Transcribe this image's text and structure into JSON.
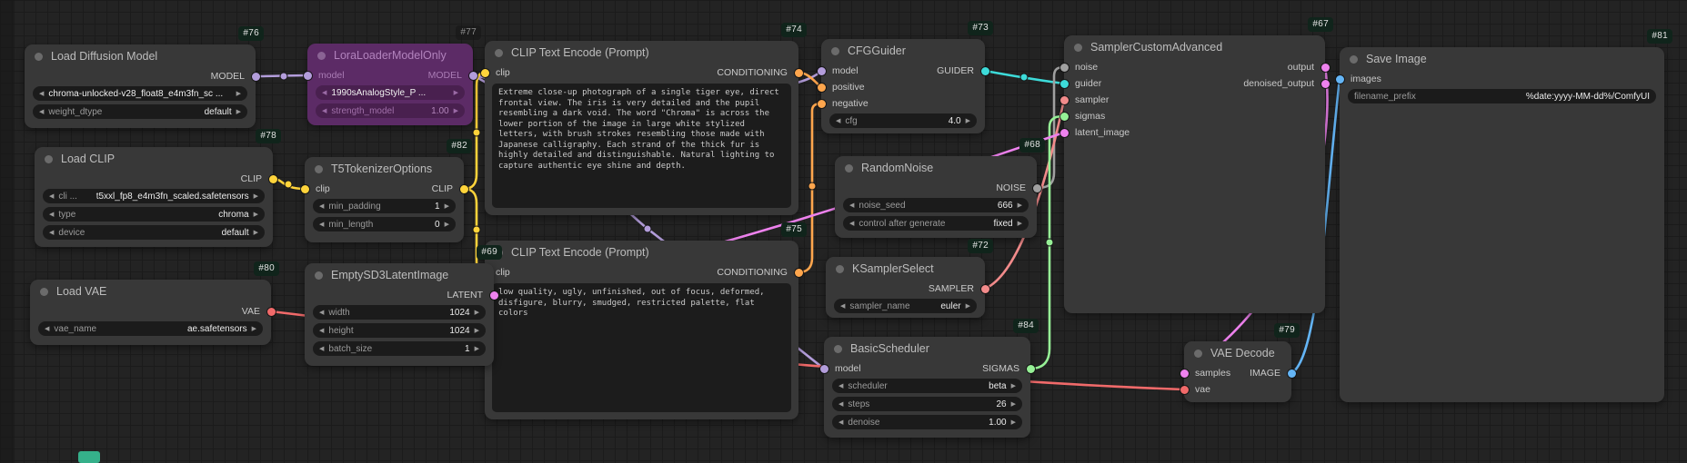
{
  "app": {
    "name": "ComfyUI workflow graph"
  },
  "colors": {
    "MODEL": "#b39ddb",
    "CLIP": "#ffd43b",
    "CONDITIONING": "#ffa64d",
    "GUIDER": "#3ddbd9",
    "NOISE": "#a0a0a0",
    "SAMPLER": "#f28b8b",
    "SIGMAS": "#96f096",
    "LATENT": "#ee82ee",
    "IMAGE": "#64b5f6",
    "VAE": "#f16a6a"
  },
  "nodes": [
    {
      "badge": "#76",
      "title": "Load Diffusion Model",
      "muted": false,
      "rows": [
        {
          "out": {
            "name": "MODEL",
            "type": "MODEL"
          }
        }
      ],
      "widgets": [
        {
          "label": "",
          "value": "chroma-unlocked-v28_float8_e4m3fn_sc ...",
          "arrows": true
        },
        {
          "label": "weight_dtype",
          "value": "default",
          "arrows": true
        }
      ]
    },
    {
      "badge": "#77",
      "title": "LoraLoaderModelOnly",
      "muted": true,
      "rows": [
        {
          "in": {
            "name": "model",
            "type": "MODEL"
          },
          "out": {
            "name": "MODEL",
            "type": "MODEL"
          }
        }
      ],
      "widgets": [
        {
          "label": "",
          "value": "1990sAnalogStyle_P ...",
          "arrows": true
        },
        {
          "label": "strength_model",
          "value": "1.00",
          "arrows": true
        }
      ]
    },
    {
      "badge": "#74",
      "title": "CLIP Text Encode (Prompt)",
      "muted": false,
      "rows": [
        {
          "in": {
            "name": "clip",
            "type": "CLIP"
          },
          "out": {
            "name": "CONDITIONING",
            "type": "CONDITIONING"
          }
        }
      ],
      "widgets": [],
      "text": "Extreme close-up photograph of a single tiger eye, direct frontal view. The iris is very detailed and the pupil resembling a dark void. The word \"Chroma\" is across the lower portion of the image in large white stylized letters, with brush strokes resembling those made with Japanese calligraphy. Each strand of the thick fur is highly detailed and distinguishable. Natural lighting to capture authentic eye shine and depth."
    },
    {
      "badge": "#73",
      "title": "CFGGuider",
      "muted": false,
      "rows": [
        {
          "in": {
            "name": "model",
            "type": "MODEL"
          },
          "out": {
            "name": "GUIDER",
            "type": "GUIDER"
          }
        },
        {
          "in": {
            "name": "positive",
            "type": "CONDITIONING"
          }
        },
        {
          "in": {
            "name": "negative",
            "type": "CONDITIONING"
          }
        }
      ],
      "widgets": [
        {
          "label": "cfg",
          "value": "4.0",
          "arrows": true
        }
      ]
    },
    {
      "badge": "#67",
      "title": "SamplerCustomAdvanced",
      "muted": false,
      "rows": [
        {
          "in": {
            "name": "noise",
            "type": "NOISE"
          },
          "out": {
            "name": "output",
            "type": "LATENT"
          }
        },
        {
          "in": {
            "name": "guider",
            "type": "GUIDER"
          },
          "out": {
            "name": "denoised_output",
            "type": "LATENT"
          }
        },
        {
          "in": {
            "name": "sampler",
            "type": "SAMPLER"
          }
        },
        {
          "in": {
            "name": "sigmas",
            "type": "SIGMAS"
          }
        },
        {
          "in": {
            "name": "latent_image",
            "type": "LATENT"
          }
        }
      ],
      "widgets": []
    },
    {
      "badge": "#81",
      "title": "Save Image",
      "muted": false,
      "rows": [
        {
          "in": {
            "name": "images",
            "type": "IMAGE"
          }
        }
      ],
      "widgets": [
        {
          "label": "filename_prefix",
          "value": "%date:yyyy-MM-dd%/ComfyUI",
          "arrows": false
        }
      ]
    },
    {
      "badge": "#78",
      "title": "Load CLIP",
      "muted": false,
      "rows": [
        {
          "out": {
            "name": "CLIP",
            "type": "CLIP"
          }
        }
      ],
      "widgets": [
        {
          "label": "cli ...",
          "value": "t5xxl_fp8_e4m3fn_scaled.safetensors",
          "arrows": true
        },
        {
          "label": "type",
          "value": "chroma",
          "arrows": true
        },
        {
          "label": "device",
          "value": "default",
          "arrows": true
        }
      ]
    },
    {
      "badge": "#82",
      "title": "T5TokenizerOptions",
      "muted": false,
      "rows": [
        {
          "in": {
            "name": "clip",
            "type": "CLIP"
          },
          "out": {
            "name": "CLIP",
            "type": "CLIP"
          }
        }
      ],
      "widgets": [
        {
          "label": "min_padding",
          "value": "1",
          "arrows": true
        },
        {
          "label": "min_length",
          "value": "0",
          "arrows": true
        }
      ]
    },
    {
      "badge": "#75",
      "title": "CLIP Text Encode (Prompt)",
      "muted": false,
      "rows": [
        {
          "in": {
            "name": "clip",
            "type": "CLIP"
          },
          "out": {
            "name": "CONDITIONING",
            "type": "CONDITIONING"
          }
        }
      ],
      "widgets": [],
      "text": "low quality, ugly, unfinished, out of focus, deformed, disfigure, blurry, smudged, restricted palette, flat colors"
    },
    {
      "badge": "#68",
      "title": "RandomNoise",
      "muted": false,
      "rows": [
        {
          "out": {
            "name": "NOISE",
            "type": "NOISE"
          }
        }
      ],
      "widgets": [
        {
          "label": "noise_seed",
          "value": "666",
          "arrows": true
        },
        {
          "label": "control after generate",
          "value": "fixed",
          "arrows": true
        }
      ]
    },
    {
      "badge": "#72",
      "title": "KSamplerSelect",
      "muted": false,
      "rows": [
        {
          "out": {
            "name": "SAMPLER",
            "type": "SAMPLER"
          }
        }
      ],
      "widgets": [
        {
          "label": "sampler_name",
          "value": "euler",
          "arrows": true
        }
      ]
    },
    {
      "badge": "#84",
      "title": "BasicScheduler",
      "muted": false,
      "rows": [
        {
          "in": {
            "name": "model",
            "type": "MODEL"
          },
          "out": {
            "name": "SIGMAS",
            "type": "SIGMAS"
          }
        }
      ],
      "widgets": [
        {
          "label": "scheduler",
          "value": "beta",
          "arrows": true
        },
        {
          "label": "steps",
          "value": "26",
          "arrows": true
        },
        {
          "label": "denoise",
          "value": "1.00",
          "arrows": true
        }
      ]
    },
    {
      "badge": "#69",
      "title": "EmptySD3LatentImage",
      "muted": false,
      "rows": [
        {
          "out": {
            "name": "LATENT",
            "type": "LATENT"
          }
        }
      ],
      "widgets": [
        {
          "label": "width",
          "value": "1024",
          "arrows": true
        },
        {
          "label": "height",
          "value": "1024",
          "arrows": true
        },
        {
          "label": "batch_size",
          "value": "1",
          "arrows": true
        }
      ]
    },
    {
      "badge": "#80",
      "title": "Load VAE",
      "muted": false,
      "rows": [
        {
          "out": {
            "name": "VAE",
            "type": "VAE"
          }
        }
      ],
      "widgets": [
        {
          "label": "vae_name",
          "value": "ae.safetensors",
          "arrows": true
        }
      ]
    },
    {
      "badge": "#79",
      "title": "VAE Decode",
      "muted": false,
      "rows": [
        {
          "in": {
            "name": "samples",
            "type": "LATENT"
          },
          "out": {
            "name": "IMAGE",
            "type": "IMAGE"
          }
        },
        {
          "in": {
            "name": "vae",
            "type": "VAE"
          }
        }
      ],
      "widgets": []
    }
  ],
  "links": [
    {
      "from": "#76.MODEL",
      "to": "#77.model",
      "type": "MODEL"
    },
    {
      "from": "#77.MODEL",
      "to": "#73.model",
      "type": "MODEL"
    },
    {
      "from": "#77.MODEL",
      "to": "#84.model",
      "type": "MODEL"
    },
    {
      "from": "#78.CLIP",
      "to": "#82.clip",
      "type": "CLIP"
    },
    {
      "from": "#82.CLIP",
      "to": "#74.clip",
      "type": "CLIP"
    },
    {
      "from": "#82.CLIP",
      "to": "#75.clip",
      "type": "CLIP"
    },
    {
      "from": "#74.CONDITIONING",
      "to": "#73.positive",
      "type": "CONDITIONING"
    },
    {
      "from": "#75.CONDITIONING",
      "to": "#73.negative",
      "type": "CONDITIONING"
    },
    {
      "from": "#73.GUIDER",
      "to": "#67.guider",
      "type": "GUIDER"
    },
    {
      "from": "#68.NOISE",
      "to": "#67.noise",
      "type": "NOISE"
    },
    {
      "from": "#72.SAMPLER",
      "to": "#67.sampler",
      "type": "SAMPLER"
    },
    {
      "from": "#84.SIGMAS",
      "to": "#67.sigmas",
      "type": "SIGMAS"
    },
    {
      "from": "#69.LATENT",
      "to": "#67.latent_image",
      "type": "LATENT"
    },
    {
      "from": "#67.output",
      "to": "#79.samples",
      "type": "LATENT"
    },
    {
      "from": "#79.IMAGE",
      "to": "#81.images",
      "type": "IMAGE"
    },
    {
      "from": "#80.VAE",
      "to": "#79.vae",
      "type": "VAE"
    }
  ]
}
